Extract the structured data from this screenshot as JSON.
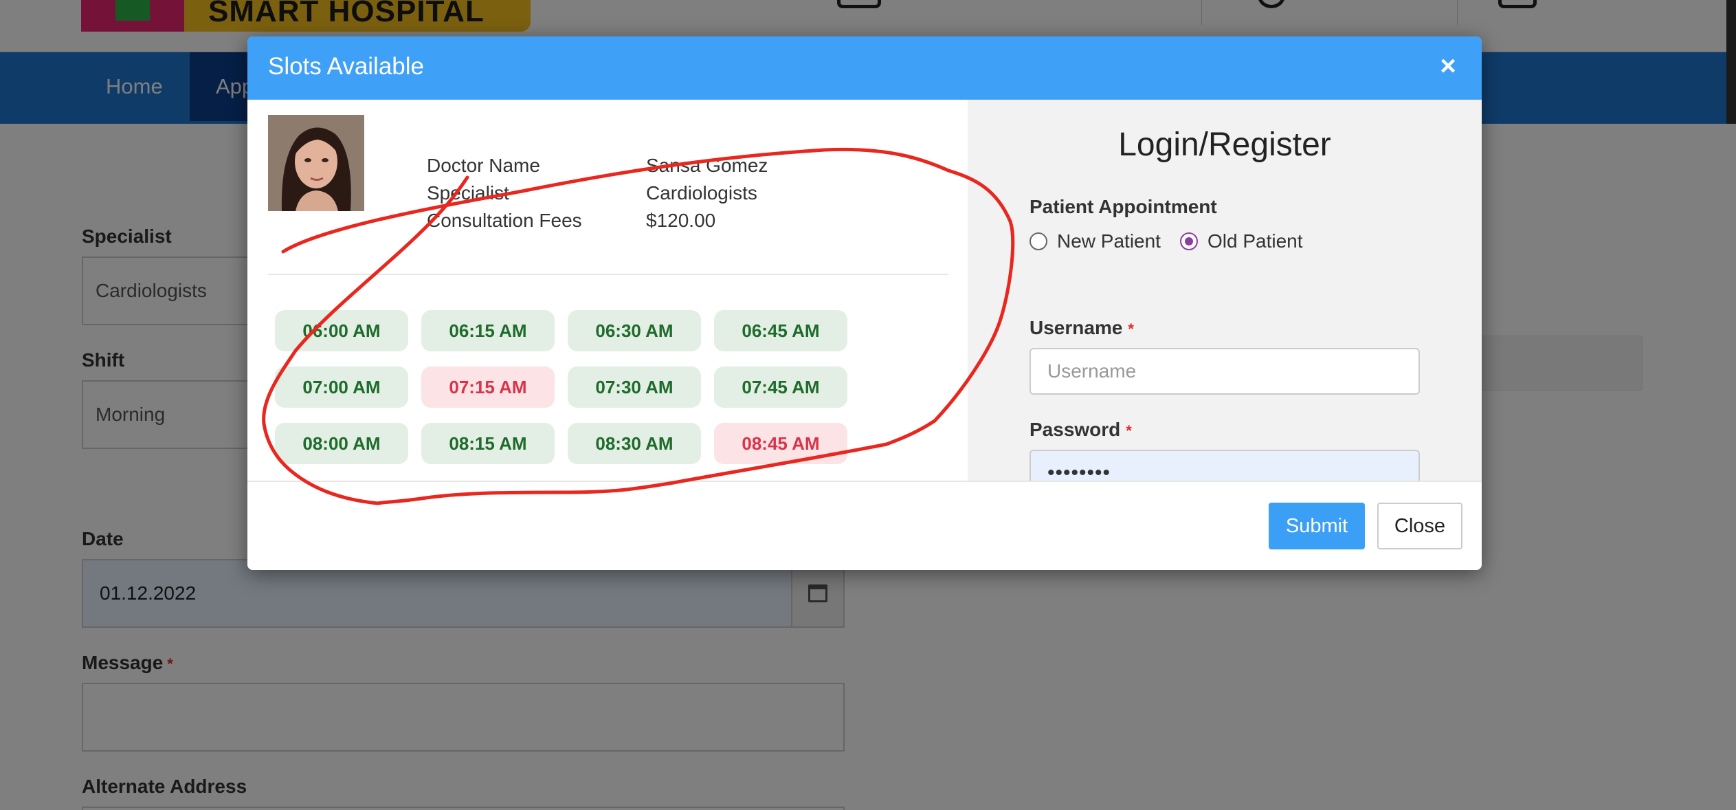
{
  "background": {
    "logo_text": "SMART HOSPITAL",
    "nav": [
      {
        "label": "Home"
      },
      {
        "label": "App"
      }
    ],
    "form": {
      "specialist_label": "Specialist",
      "specialist_value": "Cardiologists",
      "shift_label": "Shift",
      "shift_value": "Morning",
      "date_label": "Date",
      "date_value": "01.12.2022",
      "message_label": "Message",
      "message_required": "*",
      "alt_address_label": "Alternate Address"
    }
  },
  "modal": {
    "title": "Slots Available",
    "close_symbol": "×",
    "doctor": {
      "name_label": "Doctor Name",
      "name_value": "Sansa Gomez",
      "specialist_label": "Specialist",
      "specialist_value": "Cardiologists",
      "fees_label": "Consultation Fees",
      "fees_value": "$120.00"
    },
    "slots": [
      {
        "time": "06:00 AM",
        "status": "available"
      },
      {
        "time": "06:15 AM",
        "status": "available"
      },
      {
        "time": "06:30 AM",
        "status": "available"
      },
      {
        "time": "06:45 AM",
        "status": "available"
      },
      {
        "time": "07:00 AM",
        "status": "available"
      },
      {
        "time": "07:15 AM",
        "status": "booked"
      },
      {
        "time": "07:30 AM",
        "status": "available"
      },
      {
        "time": "07:45 AM",
        "status": "available"
      },
      {
        "time": "08:00 AM",
        "status": "available"
      },
      {
        "time": "08:15 AM",
        "status": "available"
      },
      {
        "time": "08:30 AM",
        "status": "available"
      },
      {
        "time": "08:45 AM",
        "status": "booked"
      }
    ],
    "login": {
      "title": "Login/Register",
      "appointment_label": "Patient Appointment",
      "new_patient": "New Patient",
      "old_patient": "Old Patient",
      "selected": "old",
      "username_label": "Username",
      "username_placeholder": "Username",
      "password_label": "Password",
      "password_value": "password",
      "required_mark": "*"
    },
    "footer": {
      "submit_label": "Submit",
      "close_label": "Close"
    }
  },
  "colors": {
    "header_blue": "#3fa0f7",
    "nav_blue": "#1f76d2",
    "slot_available_bg": "#e3efe5",
    "slot_available_text": "#1e6b2b",
    "slot_booked_bg": "#fbe3e6",
    "slot_booked_text": "#d9334a",
    "annotation_red": "#e8271f"
  }
}
